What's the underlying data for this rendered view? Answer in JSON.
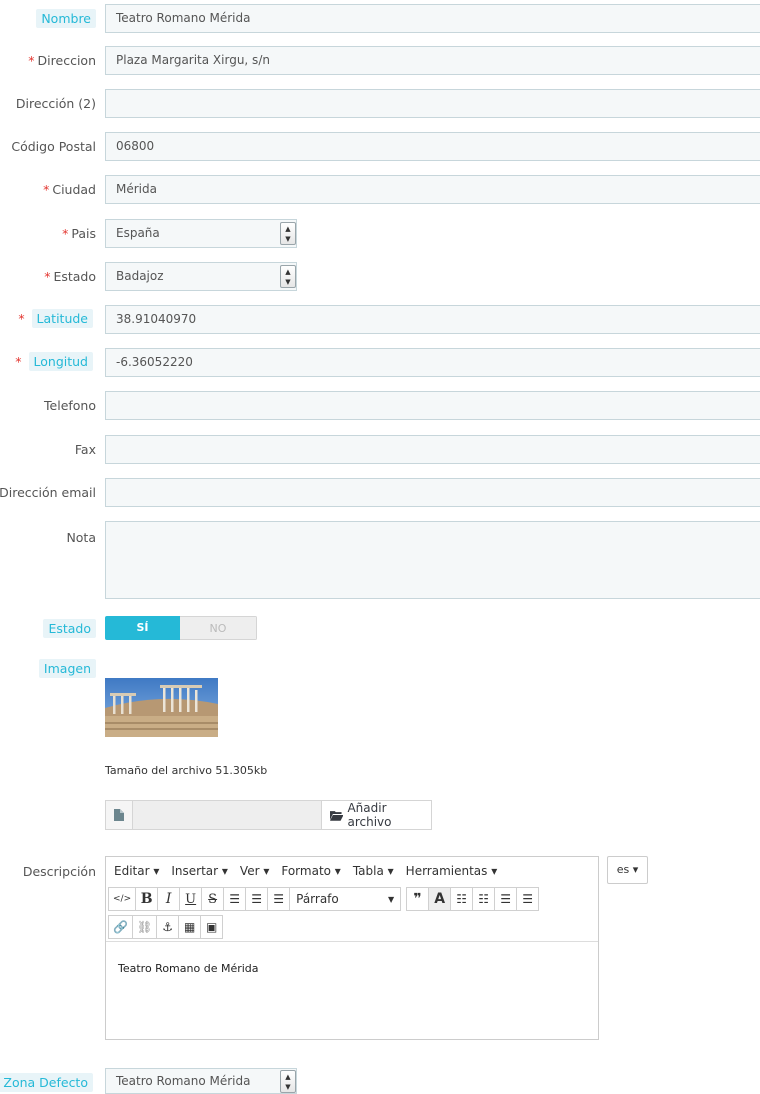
{
  "fields": {
    "nombre": {
      "label": "Nombre",
      "value": "Teatro Romano Mérida"
    },
    "direccion": {
      "label": "Direccion",
      "required": "*",
      "value": "Plaza Margarita Xirgu, s/n"
    },
    "direccion2": {
      "label": "Dirección (2)",
      "value": ""
    },
    "codigo_postal": {
      "label": "Código Postal",
      "value": "06800"
    },
    "ciudad": {
      "label": "Ciudad",
      "required": "*",
      "value": "Mérida"
    },
    "pais": {
      "label": "Pais",
      "required": "*",
      "value": "España"
    },
    "estado_prov": {
      "label": "Estado",
      "required": "*",
      "value": "Badajoz"
    },
    "latitude": {
      "label": "Latitude",
      "required": "*",
      "value": "38.91040970"
    },
    "longitud": {
      "label": "Longitud",
      "required": "*",
      "value": "-6.36052220"
    },
    "telefono": {
      "label": "Telefono",
      "value": ""
    },
    "fax": {
      "label": "Fax",
      "value": ""
    },
    "email": {
      "label": "Dirección email",
      "value": ""
    },
    "nota": {
      "label": "Nota",
      "value": ""
    }
  },
  "estado_toggle": {
    "label": "Estado",
    "on_label": "SÍ",
    "off_label": "NO",
    "selected": "SÍ"
  },
  "imagen": {
    "label": "Imagen",
    "file_size_text": "Tamaño del archivo 51.305kb",
    "add_file_label": "Añadir archivo"
  },
  "descripcion": {
    "label": "Descripción",
    "menu": [
      "Editar ▾",
      "Insertar ▾",
      "Ver ▾",
      "Formato ▾",
      "Tabla ▾",
      "Herramientas ▾"
    ],
    "format_select": "Párrafo",
    "content": "Teatro Romano de Mérida",
    "lang": "es ▾"
  },
  "zona_defecto": {
    "label": "Zona Defecto",
    "value": "Teatro Romano Mérida"
  },
  "colors": {
    "accent": "#25b9d7",
    "required": "#e3352f",
    "input_bg": "#f5f8f9"
  }
}
